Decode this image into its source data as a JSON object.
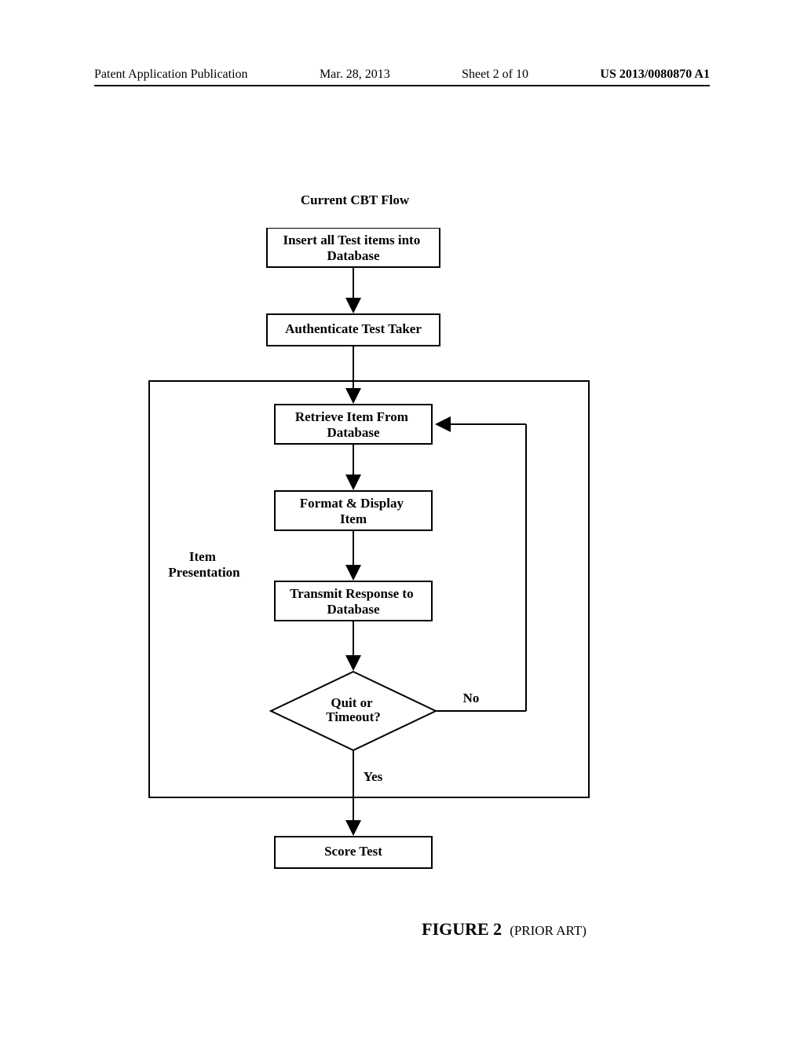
{
  "header": {
    "pub_title": "Patent Application Publication",
    "date": "Mar. 28, 2013",
    "sheet": "Sheet 2 of 10",
    "patno": "US 2013/0080870 A1"
  },
  "diagram": {
    "title": "Current CBT Flow",
    "loop_label": "Item\nPresentation",
    "boxes": {
      "insert": "Insert all Test items into\nDatabase",
      "auth": "Authenticate Test Taker",
      "retrieve": "Retrieve Item From\nDatabase",
      "format": "Format & Display\nItem",
      "transmit": "Transmit Response to\nDatabase",
      "decision": "Quit or\nTimeout?",
      "score": "Score Test"
    },
    "edges": {
      "no": "No",
      "yes": "Yes"
    }
  },
  "caption": {
    "figure": "FIGURE 2",
    "annotation": "(PRIOR ART)"
  }
}
